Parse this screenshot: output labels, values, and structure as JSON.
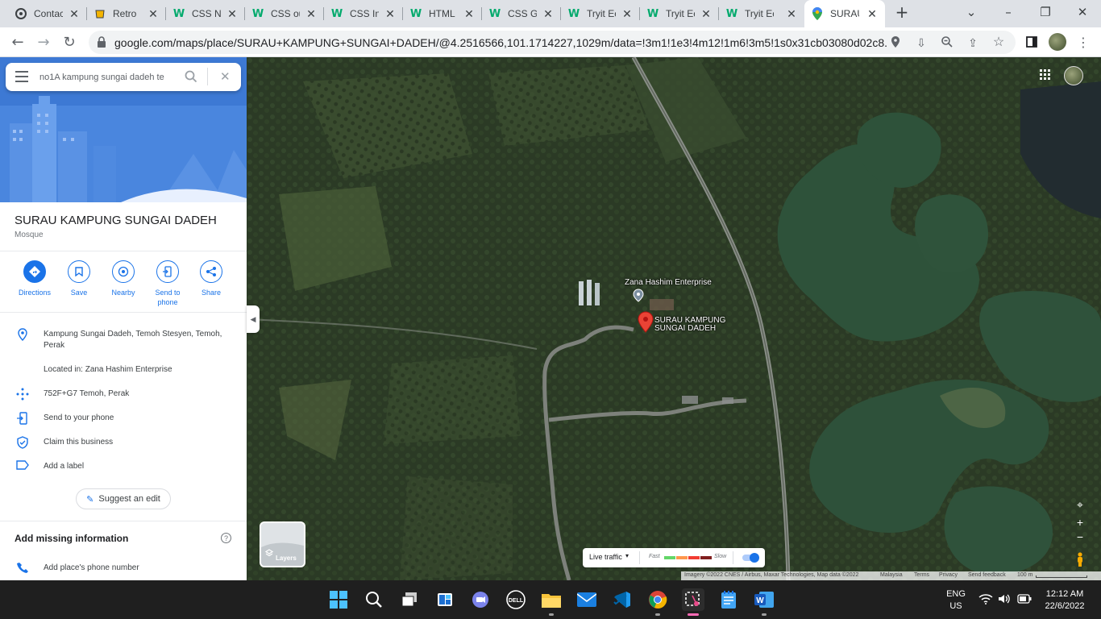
{
  "browser": {
    "tabs": [
      {
        "title": "Contac",
        "icon": "contact-site-icon"
      },
      {
        "title": "Retro",
        "icon": "retro-cup-icon"
      },
      {
        "title": "CSS N",
        "icon": "w3schools-icon"
      },
      {
        "title": "CSS ou",
        "icon": "w3schools-icon"
      },
      {
        "title": "CSS In",
        "icon": "w3schools-icon"
      },
      {
        "title": "HTML",
        "icon": "w3schools-icon"
      },
      {
        "title": "CSS G",
        "icon": "w3schools-icon"
      },
      {
        "title": "Tryit Ec",
        "icon": "w3schools-icon"
      },
      {
        "title": "Tryit Ec",
        "icon": "w3schools-icon"
      },
      {
        "title": "Tryit Ec",
        "icon": "w3schools-icon"
      },
      {
        "title": "SURAU",
        "icon": "google-maps-icon",
        "active": true
      }
    ],
    "url": "google.com/maps/place/SURAU+KAMPUNG+SUNGAI+DADEH/@4.2516566,101.1714227,1029m/data=!3m1!1e3!4m12!1m6!3m5!1s0x31cb03080d02c8..."
  },
  "maps": {
    "search_value": "no1A kampung sungai dadeh te",
    "place_name": "SURAU KAMPUNG SUNGAI DADEH",
    "category": "Mosque",
    "actions": [
      {
        "label": "Directions",
        "icon": "directions-icon"
      },
      {
        "label": "Save",
        "icon": "bookmark-icon"
      },
      {
        "label": "Nearby",
        "icon": "nearby-icon"
      },
      {
        "label": "Send to phone",
        "icon": "send-to-phone-icon"
      },
      {
        "label": "Share",
        "icon": "share-icon"
      }
    ],
    "info": [
      {
        "text": "Kampung Sungai Dadeh, Temoh Stesyen, Temoh, Perak",
        "icon": "location-pin-icon"
      },
      {
        "text": "Located in: Zana Hashim Enterprise",
        "icon": ""
      },
      {
        "text": "752F+G7 Temoh, Perak",
        "icon": "plus-code-icon"
      },
      {
        "text": "Send to your phone",
        "icon": "send-to-phone-icon"
      },
      {
        "text": "Claim this business",
        "icon": "verified-shield-icon"
      },
      {
        "text": "Add a label",
        "icon": "label-icon"
      }
    ],
    "suggest_edit": "Suggest an edit",
    "missing_info_title": "Add missing information",
    "add_phone": "Add place's phone number",
    "map_labels": {
      "enterprise": "Zana Hashim Enterprise",
      "place_line1": "SURAU KAMPUNG",
      "place_line2": "SUNGAI DADEH"
    },
    "layers_label": "Layers",
    "traffic": {
      "label": "Live traffic",
      "fast": "Fast",
      "slow": "Slow",
      "colors": [
        "#63d668",
        "#ff974d",
        "#f23c32",
        "#811f1f"
      ]
    },
    "attribution": {
      "imagery": "Imagery ©2022 CNES / Airbus, Maxar Technologies, Map data ©2022",
      "country": "Malaysia",
      "terms": "Terms",
      "privacy": "Privacy",
      "feedback": "Send feedback",
      "scale": "100 m"
    }
  },
  "taskbar": {
    "apps": [
      "windows-start-icon",
      "search-icon",
      "task-view-icon",
      "widgets-icon",
      "teams-chat-icon",
      "dell-icon",
      "file-explorer-icon",
      "mail-icon",
      "vscode-icon",
      "chrome-icon",
      "snipping-tool-icon",
      "notepad-icon",
      "word-icon"
    ],
    "lang_line1": "ENG",
    "lang_line2": "US",
    "time": "12:12 AM",
    "date": "22/6/2022"
  }
}
